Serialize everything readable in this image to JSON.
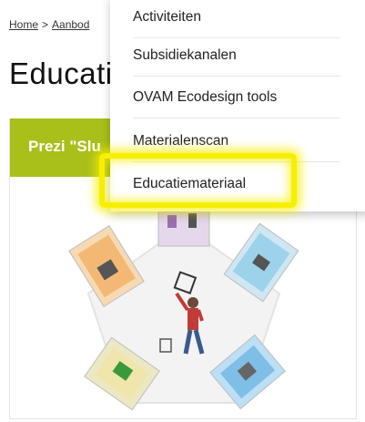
{
  "breadcrumb": {
    "home": "Home",
    "separator": ">",
    "current": "Aanbod"
  },
  "page": {
    "title": "Educati"
  },
  "card": {
    "header_text": "Prezi \"Slu",
    "accent_color": "#a9bf1a"
  },
  "dropdown": {
    "items": [
      {
        "label": "Activiteiten"
      },
      {
        "label": "Subsidiekanalen"
      },
      {
        "label": "OVAM Ecodesign tools"
      },
      {
        "label": "Materialenscan"
      },
      {
        "label": "Educatiemateriaal",
        "highlighted": true
      }
    ],
    "highlight_color": "#f6f000"
  }
}
